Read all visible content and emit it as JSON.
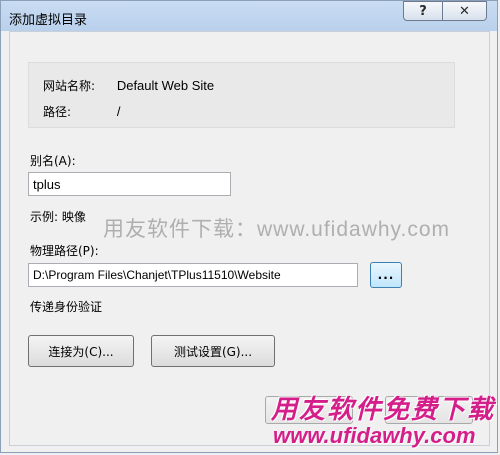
{
  "window": {
    "title": "添加虚拟目录",
    "help_label": "?",
    "close_label": "✕"
  },
  "info": {
    "site_name_label": "网站名称:",
    "site_name_value": "Default Web Site",
    "path_label": "路径:",
    "path_value": "/"
  },
  "alias": {
    "label": "别名(A):",
    "value": "tplus",
    "example": "示例: 映像"
  },
  "physical_path": {
    "label": "物理路径(P):",
    "value": "D:\\Program Files\\Chanjet\\TPlus11510\\Website",
    "browse_label": "..."
  },
  "auth": {
    "label": "传递身份验证",
    "connect_as_label": "连接为(C)...",
    "test_settings_label": "测试设置(G)..."
  },
  "watermarks": {
    "center_text": "用友软件下载：www.ufidawhy.com",
    "logo_cn": "用友软件免费下载",
    "logo_url": "www.ufidawhy.com"
  }
}
